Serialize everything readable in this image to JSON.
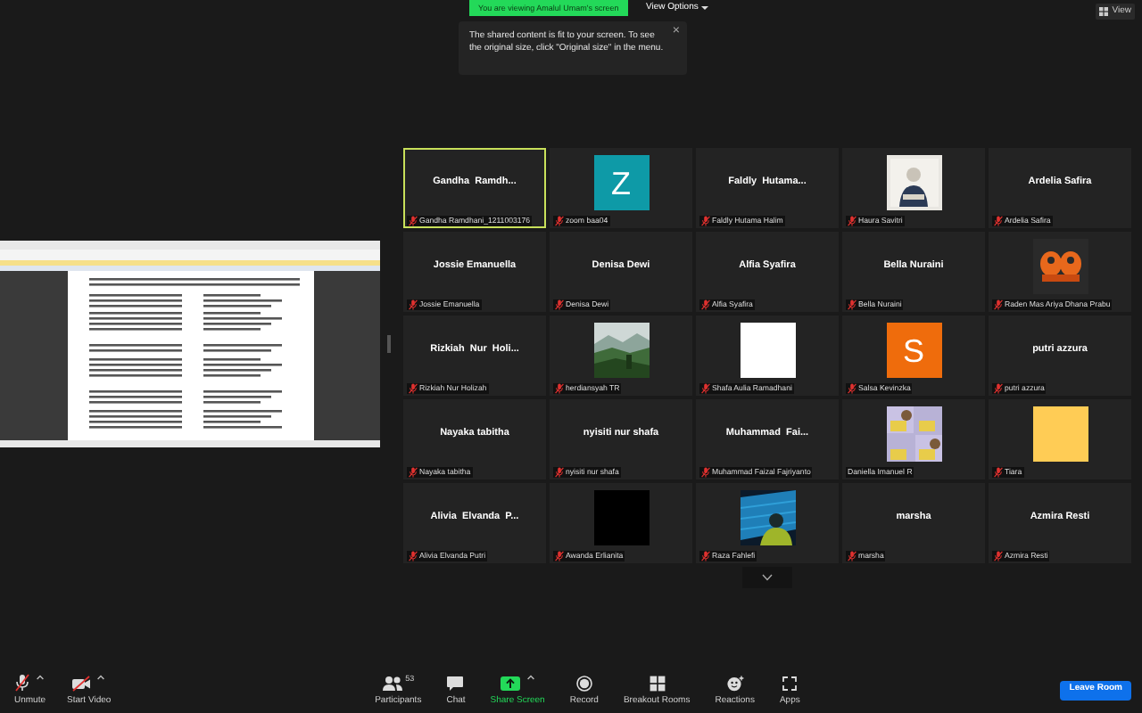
{
  "top_bar": {
    "banner": "You are viewing Amalul Umam's screen",
    "view_options": "View Options",
    "view": "View"
  },
  "tooltip": {
    "text": "The shared content is fit to your screen. To see the original size, click \"Original size\" in the menu.",
    "close": "×"
  },
  "gallery": {
    "tiles": [
      {
        "kind": "name",
        "title": "Gandha  Ramdh...",
        "label": "Gandha Ramdhani_1211003176",
        "muted": true,
        "speaking": true
      },
      {
        "kind": "avatar",
        "letter": "Z",
        "color": "#0e9aa7",
        "label": "zoom baa04",
        "muted": true,
        "speaking": false
      },
      {
        "kind": "name",
        "title": "Faldly  Hutama...",
        "label": "Faldly Hutama Halim",
        "muted": true,
        "speaking": false
      },
      {
        "kind": "picture",
        "label": "Haura Savitri",
        "muted": true,
        "speaking": false
      },
      {
        "kind": "name",
        "title": "Ardelia Safira",
        "label": "Ardelia Safira",
        "muted": true,
        "speaking": false
      },
      {
        "kind": "name",
        "title": "Jossie Emanuella",
        "label": "Jossie Emanuella",
        "muted": true,
        "speaking": false
      },
      {
        "kind": "name",
        "title": "Denisa Dewi",
        "label": "Denisa Dewi",
        "muted": true,
        "speaking": false
      },
      {
        "kind": "name",
        "title": "Alfia Syafira",
        "label": "Alfia Syafira",
        "muted": true,
        "speaking": false
      },
      {
        "kind": "name",
        "title": "Bella Nuraini",
        "label": "Bella Nuraini",
        "muted": true,
        "speaking": false
      },
      {
        "kind": "picture",
        "label": "Raden Mas Ariya Dhana Prabu",
        "muted": true,
        "speaking": false
      },
      {
        "kind": "name",
        "title": "Rizkiah  Nur  Holi...",
        "label": "Rizkiah Nur Holizah",
        "muted": true,
        "speaking": false
      },
      {
        "kind": "picture",
        "label": "herdiansyah TR",
        "muted": true,
        "speaking": false
      },
      {
        "kind": "swatch",
        "color": "#ffffff",
        "label": "Shafa Aulia Ramadhani",
        "muted": true,
        "speaking": false
      },
      {
        "kind": "avatar",
        "letter": "S",
        "color": "#ef6c0c",
        "label": "Salsa Kevinzka",
        "muted": true,
        "speaking": false
      },
      {
        "kind": "name",
        "title": "putri azzura",
        "label": "putri azzura",
        "muted": true,
        "speaking": false
      },
      {
        "kind": "name",
        "title": "Nayaka tabitha",
        "label": "Nayaka tabitha",
        "muted": true,
        "speaking": false
      },
      {
        "kind": "name",
        "title": "nyisiti nur shafa",
        "label": "nyisiti nur shafa",
        "muted": true,
        "speaking": false
      },
      {
        "kind": "name",
        "title": "Muhammad  Fai...",
        "label": "Muhammad Faizal Fajriyanto",
        "muted": true,
        "speaking": false
      },
      {
        "kind": "picture",
        "label": "Daniella Imanuel R",
        "muted": false,
        "speaking": false
      },
      {
        "kind": "swatch",
        "color": "#ffcc55",
        "label": "Tiara",
        "muted": true,
        "speaking": false
      },
      {
        "kind": "name",
        "title": "Alivia  Elvanda  P...",
        "label": "Alivia Elvanda Putri",
        "muted": true,
        "speaking": false
      },
      {
        "kind": "swatch",
        "color": "#000000",
        "label": "Awanda Erlianita",
        "muted": true,
        "speaking": false
      },
      {
        "kind": "picture",
        "label": "Raza Fahlefi",
        "muted": true,
        "speaking": false
      },
      {
        "kind": "name",
        "title": "marsha",
        "label": "marsha",
        "muted": true,
        "speaking": false
      },
      {
        "kind": "name",
        "title": "Azmira Resti",
        "label": "Azmira Resti",
        "muted": true,
        "speaking": false
      }
    ]
  },
  "toolbar": {
    "items": [
      {
        "label": "Unmute",
        "highlight": false,
        "has_menu": true
      },
      {
        "label": "Start Video",
        "highlight": false,
        "has_menu": true
      },
      {
        "label": "Participants",
        "count": "53",
        "highlight": false,
        "has_menu": false
      },
      {
        "label": "Chat",
        "highlight": false,
        "has_menu": false
      },
      {
        "label": "Share Screen",
        "highlight": true,
        "has_menu": true
      },
      {
        "label": "Record",
        "highlight": false,
        "has_menu": false
      },
      {
        "label": "Breakout Rooms",
        "highlight": false,
        "has_menu": false
      },
      {
        "label": "Reactions",
        "highlight": false,
        "has_menu": false
      },
      {
        "label": "Apps",
        "highlight": false,
        "has_menu": false
      }
    ],
    "leave": "Leave Room"
  }
}
